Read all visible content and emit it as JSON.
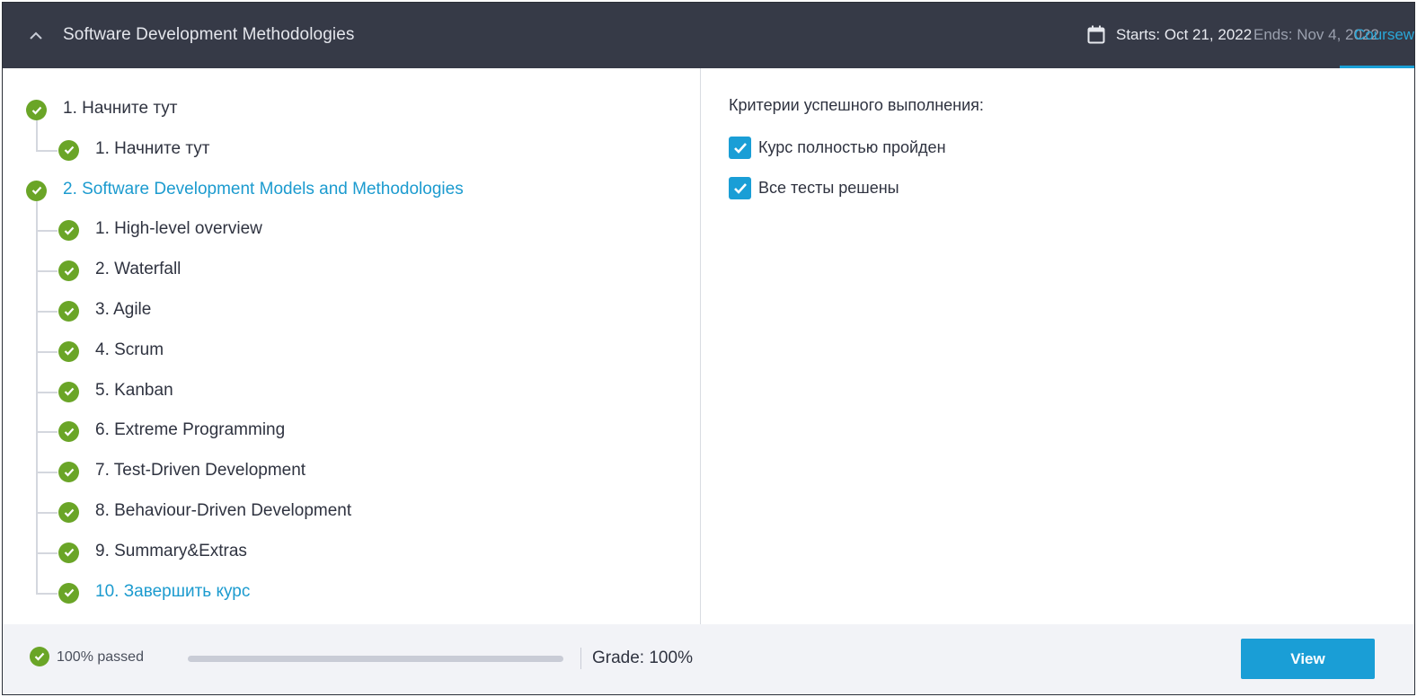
{
  "header": {
    "title": "Software Development Methodologies",
    "starts": "Starts: Oct 21, 2022",
    "ends": "Ends: Nov 4, 2022",
    "tab": "Coursew"
  },
  "tree": [
    {
      "label": "1. Начните тут",
      "level": 0,
      "active": false
    },
    {
      "label": "1. Начните тут",
      "level": 1,
      "active": false
    },
    {
      "label": "2. Software Development Models and Methodologies",
      "level": 0,
      "active": true
    },
    {
      "label": "1. High-level overview",
      "level": 1,
      "active": false
    },
    {
      "label": "2. Waterfall",
      "level": 1,
      "active": false
    },
    {
      "label": "3. Agile",
      "level": 1,
      "active": false
    },
    {
      "label": "4. Scrum",
      "level": 1,
      "active": false
    },
    {
      "label": "5. Kanban",
      "level": 1,
      "active": false
    },
    {
      "label": "6. Extreme Programming",
      "level": 1,
      "active": false
    },
    {
      "label": "7. Test-Driven Development",
      "level": 1,
      "active": false
    },
    {
      "label": "8. Behaviour-Driven Development",
      "level": 1,
      "active": false
    },
    {
      "label": "9. Summary&Extras",
      "level": 1,
      "active": false
    },
    {
      "label": "10. Завершить курс",
      "level": 1,
      "active": true
    }
  ],
  "criteria": {
    "title": "Критерии успешного выполнения:",
    "items": [
      {
        "label": "Курс полностью пройден",
        "checked": true
      },
      {
        "label": "Все тесты решены",
        "checked": true
      }
    ]
  },
  "footer": {
    "passed": "100% passed",
    "progress": 1.0,
    "grade": "Grade: 100%",
    "view_label": "View"
  },
  "colors": {
    "header_bg": "#363a47",
    "accent": "#1a9ed6",
    "success": "#6aa527"
  }
}
